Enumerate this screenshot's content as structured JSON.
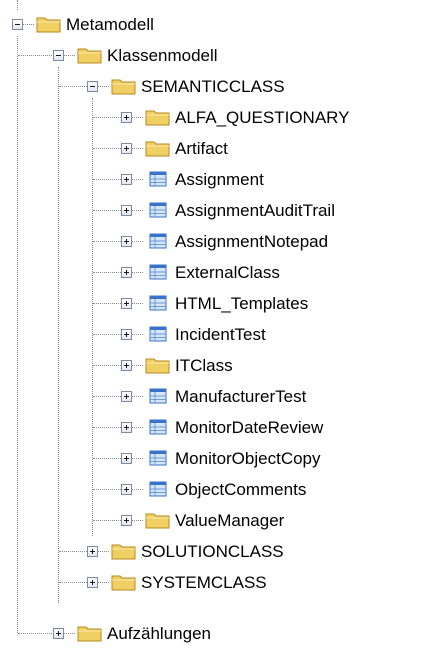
{
  "tree": {
    "nodes": [
      {
        "label": "Metamodell",
        "icon": "folder-icon",
        "expanded": true
      },
      {
        "label": "Klassenmodell",
        "icon": "folder-icon",
        "expanded": true
      },
      {
        "label": "SEMANTICCLASS",
        "icon": "folder-icon",
        "expanded": true
      },
      {
        "label": "ALFA_QUESTIONARY",
        "icon": "folder-icon",
        "expanded": false
      },
      {
        "label": "Artifact",
        "icon": "folder-icon",
        "expanded": false
      },
      {
        "label": "Assignment",
        "icon": "class-icon",
        "expanded": false
      },
      {
        "label": "AssignmentAuditTrail",
        "icon": "class-icon",
        "expanded": false
      },
      {
        "label": "AssignmentNotepad",
        "icon": "class-icon",
        "expanded": false
      },
      {
        "label": "ExternalClass",
        "icon": "class-icon",
        "expanded": false
      },
      {
        "label": "HTML_Templates",
        "icon": "class-icon",
        "expanded": false
      },
      {
        "label": "IncidentTest",
        "icon": "class-icon",
        "expanded": false
      },
      {
        "label": "ITClass",
        "icon": "folder-icon",
        "expanded": false
      },
      {
        "label": "ManufacturerTest",
        "icon": "class-icon",
        "expanded": false
      },
      {
        "label": "MonitorDateReview",
        "icon": "class-icon",
        "expanded": false
      },
      {
        "label": "MonitorObjectCopy",
        "icon": "class-icon",
        "expanded": false
      },
      {
        "label": "ObjectComments",
        "icon": "class-icon",
        "expanded": false
      },
      {
        "label": "ValueManager",
        "icon": "folder-icon",
        "expanded": false
      },
      {
        "label": "SOLUTIONCLASS",
        "icon": "folder-icon",
        "expanded": false
      },
      {
        "label": "SYSTEMCLASS",
        "icon": "folder-icon",
        "expanded": false
      },
      {
        "label": "Aufzählungen",
        "icon": "folder-icon",
        "expanded": false
      }
    ]
  },
  "colors": {
    "folder": "#f0d063",
    "folder_dark": "#b88a1c",
    "class_header": "#3a72c8",
    "class_cell": "#d6e6f8",
    "connector": "#8a8a8a"
  }
}
